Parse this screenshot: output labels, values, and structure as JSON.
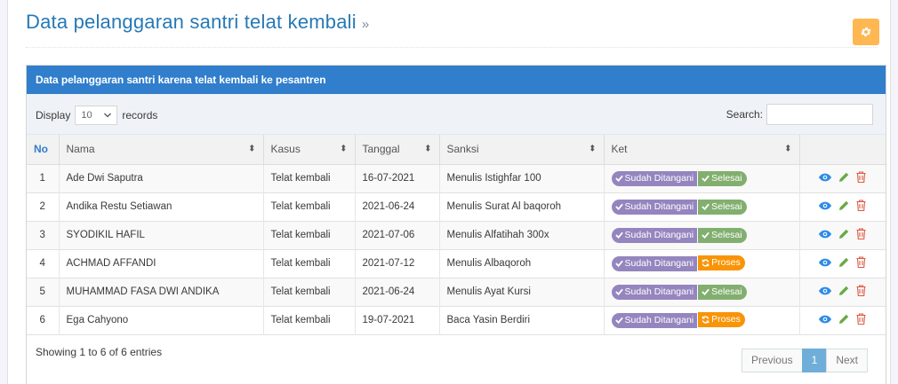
{
  "page": {
    "title": "Data pelanggaran santri telat kembali",
    "title_suffix": "»"
  },
  "box": {
    "header": "Data pelanggaran santri karena telat kembali ke pesantren"
  },
  "toolbar": {
    "display_label": "Display",
    "page_length": "10",
    "records_label": "records",
    "search_label": "Search:",
    "search_value": ""
  },
  "table": {
    "columns": [
      "No",
      "Nama",
      "Kasus",
      "Tanggal",
      "Sanksi",
      "Ket",
      ""
    ],
    "rows": [
      {
        "no": "1",
        "nama": "Ade Dwi Saputra",
        "kasus": "Telat kembali",
        "tanggal": "16-07-2021",
        "sanksi": "Menulis Istighfar 100",
        "ket1": "Sudah Ditangani",
        "ket2": "Selesai",
        "status": "selesai"
      },
      {
        "no": "2",
        "nama": "Andika Restu Setiawan",
        "kasus": "Telat kembali",
        "tanggal": "2021-06-24",
        "sanksi": "Menulis Surat Al baqoroh",
        "ket1": "Sudah Ditangani",
        "ket2": "Selesai",
        "status": "selesai"
      },
      {
        "no": "3",
        "nama": "SYODIKIL HAFIL",
        "kasus": "Telat kembali",
        "tanggal": "2021-07-06",
        "sanksi": "Menulis Alfatihah 300x",
        "ket1": "Sudah Ditangani",
        "ket2": "Selesai",
        "status": "selesai"
      },
      {
        "no": "4",
        "nama": "ACHMAD AFFANDI",
        "kasus": "Telat kembali",
        "tanggal": "2021-07-12",
        "sanksi": "Menulis Albaqoroh",
        "ket1": "Sudah Ditangani",
        "ket2": "Proses",
        "status": "proses"
      },
      {
        "no": "5",
        "nama": "MUHAMMAD FASA DWI ANDIKA",
        "kasus": "Telat kembali",
        "tanggal": "2021-06-24",
        "sanksi": "Menulis Ayat Kursi",
        "ket1": "Sudah Ditangani",
        "ket2": "Selesai",
        "status": "selesai"
      },
      {
        "no": "6",
        "nama": "Ega Cahyono",
        "kasus": "Telat kembali",
        "tanggal": "19-07-2021",
        "sanksi": "Baca Yasin Berdiri",
        "ket1": "Sudah Ditangani",
        "ket2": "Proses",
        "status": "proses"
      }
    ]
  },
  "footer": {
    "info": "Showing 1 to 6 of 6 entries",
    "previous": "Previous",
    "current_page": "1",
    "next": "Next"
  },
  "colors": {
    "title": "#2679b5",
    "header_bar": "#307ecc",
    "badge_handled": "#9585bf",
    "badge_done": "#82af6f",
    "badge_process": "#f89406",
    "view_icon": "#2e8ce6",
    "edit_icon": "#69aa46",
    "delete_icon": "#dd5a43"
  },
  "icons": [
    "gear-icon",
    "sort-icon",
    "check-icon",
    "refresh-icon",
    "eye-icon",
    "pencil-icon",
    "trash-icon",
    "chevron-down-icon"
  ]
}
